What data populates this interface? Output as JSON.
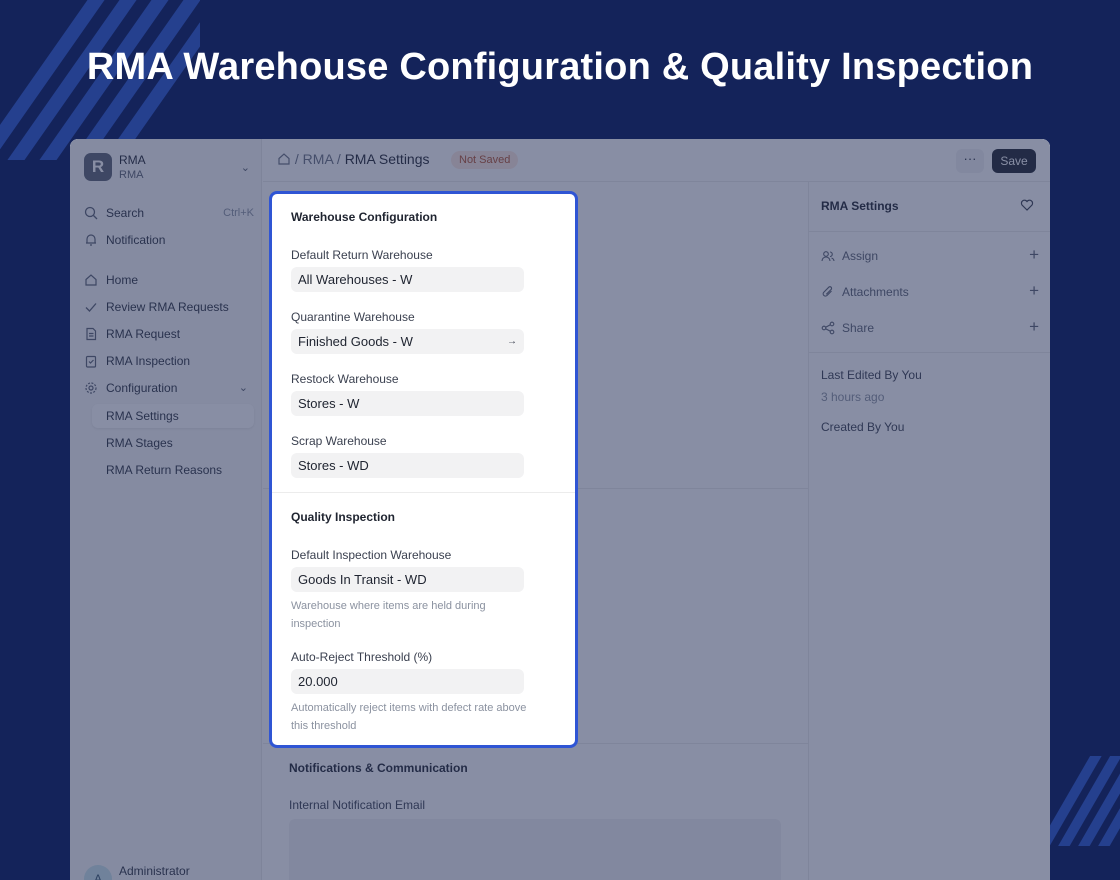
{
  "headline": "RMA Warehouse Configuration & Quality Inspection",
  "sidebar": {
    "brand_letter": "R",
    "brand_title": "RMA",
    "brand_subtitle": "RMA",
    "search_label": "Search",
    "search_shortcut": "Ctrl+K",
    "notification_label": "Notification",
    "items": [
      {
        "label": "Home",
        "icon": "home-icon"
      },
      {
        "label": "Review RMA Requests",
        "icon": "check-icon"
      },
      {
        "label": "RMA Request",
        "icon": "document-icon"
      },
      {
        "label": "RMA Inspection",
        "icon": "clipboard-icon"
      },
      {
        "label": "Configuration",
        "icon": "gear-icon"
      }
    ],
    "sub_items": [
      {
        "label": "RMA Settings",
        "active": true
      },
      {
        "label": "RMA Stages",
        "active": false
      },
      {
        "label": "RMA Return Reasons",
        "active": false
      }
    ],
    "user_initial": "A",
    "user_name": "Administrator"
  },
  "topbar": {
    "crumb_1": "RMA",
    "crumb_2": "RMA Settings",
    "status_badge": "Not Saved",
    "more_label": "···",
    "save_label": "Save"
  },
  "main": {
    "section_notifications": "Notifications & Communication",
    "internal_email_label": "Internal Notification Email"
  },
  "card": {
    "warehouse_title": "Warehouse Configuration",
    "default_return_label": "Default Return Warehouse",
    "default_return_value": "All Warehouses - W",
    "quarantine_label": "Quarantine Warehouse",
    "quarantine_value": "Finished Goods - W",
    "quarantine_arrow": "→",
    "restock_label": "Restock Warehouse",
    "restock_value": "Stores - W",
    "scrap_label": "Scrap Warehouse",
    "scrap_value": "Stores - WD",
    "quality_title": "Quality Inspection",
    "inspection_label": "Default Inspection Warehouse",
    "inspection_value": "Goods In Transit - WD",
    "inspection_help": "Warehouse where items are held during inspection",
    "threshold_label": "Auto-Reject Threshold (%)",
    "threshold_value": "20.000",
    "threshold_help": "Automatically reject items with defect rate above this threshold"
  },
  "rpanel": {
    "title": "RMA Settings",
    "assign_label": "Assign",
    "attachments_label": "Attachments",
    "share_label": "Share",
    "last_edited": "Last Edited By You",
    "last_edited_time": "3 hours ago",
    "created_by": "Created By You"
  },
  "colors": {
    "background": "#14235a",
    "highlight_border": "#2f55d4",
    "save_button": "#1f2430",
    "badge_bg": "#fde8e1"
  }
}
